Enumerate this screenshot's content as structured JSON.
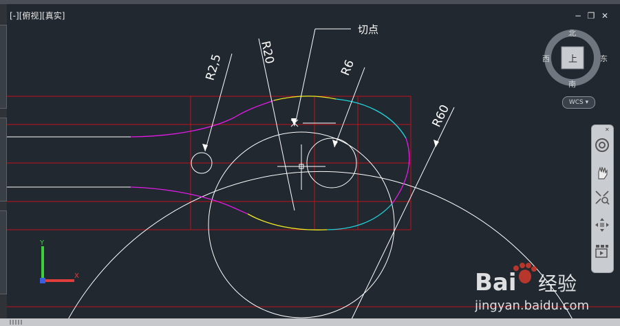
{
  "viewport": {
    "label": "[-][俯视][真实]",
    "annotations": {
      "r25": "R2,5",
      "r20": "R20",
      "r6": "R6",
      "r60": "R60",
      "tangent_point": "切点"
    },
    "colors": {
      "background": "#212830",
      "grid_red": "#c0121a",
      "white": "#ffffff",
      "magenta": "#e21ce6",
      "yellow": "#f2ee22",
      "cyan": "#1fd8e0"
    }
  },
  "window_controls": {
    "minimize": "−",
    "restore": "❐",
    "close": "✕"
  },
  "viewcube": {
    "north": "北",
    "south": "南",
    "east": "东",
    "west": "西",
    "top": "上",
    "wcs": "WCS"
  },
  "navbar": {
    "close": "✕",
    "icons": [
      "steering-wheel-icon",
      "pan-hand-icon",
      "zoom-extents-icon",
      "orbit-icon",
      "showmotion-icon"
    ]
  },
  "ucs": {
    "y_label": "Y",
    "x_label": "X"
  },
  "watermark": {
    "brand": "Bai",
    "brand_suffix": "经验",
    "url": "jingyan.baidu.com"
  }
}
